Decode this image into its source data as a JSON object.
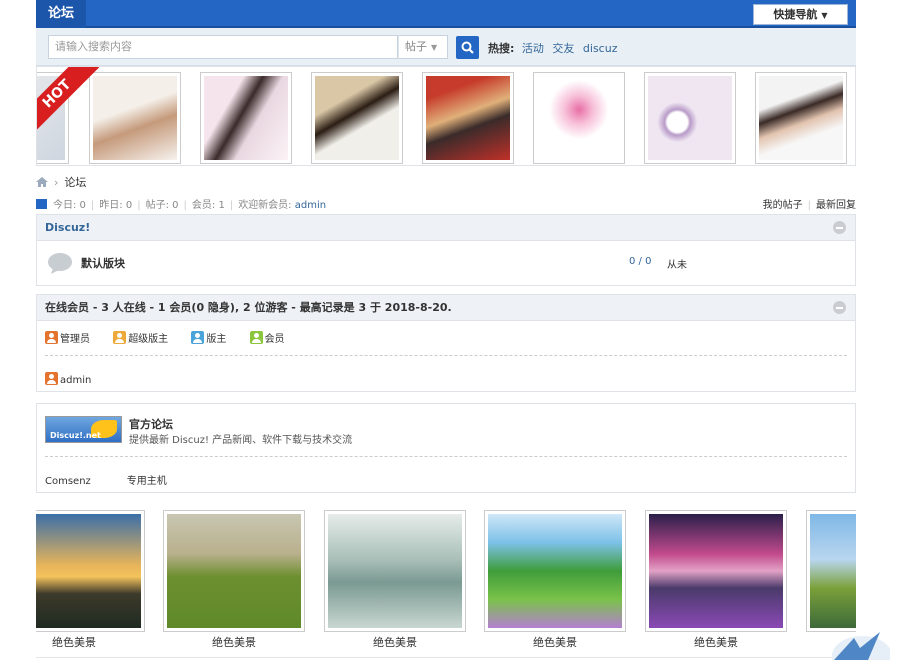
{
  "topbar": {
    "tab": "论坛",
    "quicknav": "快捷导航"
  },
  "search": {
    "placeholder": "请输入搜索内容",
    "type": "帖子",
    "hot_label": "热搜:",
    "hot_items": [
      "活动",
      "交友",
      "discuz"
    ]
  },
  "strip": {
    "badge": "HOT"
  },
  "breadcrumb": {
    "current": "论坛"
  },
  "stats": {
    "today": "今日: 0",
    "yesterday": "昨日: 0",
    "posts": "帖子: 0",
    "members": "会员: 1",
    "welcome": "欢迎新会员:",
    "newest": "admin",
    "my_posts": "我的帖子",
    "latest": "最新回复"
  },
  "forum": {
    "group": "Discuz!",
    "name": "默认版块",
    "count": "0 / 0",
    "last": "从未"
  },
  "online": {
    "title": "在线会员 - 3 人在线 - 1 会员(0 隐身), 2 位游客 - 最高记录是 3 于 2018-8-20.",
    "legend": [
      "管理员",
      "超级版主",
      "版主",
      "会员"
    ],
    "user": "admin"
  },
  "official": {
    "logo": "Discuz!.net",
    "title": "官方论坛",
    "desc": "提供最新 Discuz! 产品新闻、软件下载与技术交流",
    "links": [
      "Comsenz",
      "专用主机"
    ]
  },
  "gallery": {
    "captions": [
      "绝色美景",
      "绝色美景",
      "绝色美景",
      "绝色美景",
      "绝色美景"
    ]
  },
  "colors": {
    "primary": "#2366c4",
    "link": "#336699",
    "hot": "#d81e1e"
  }
}
